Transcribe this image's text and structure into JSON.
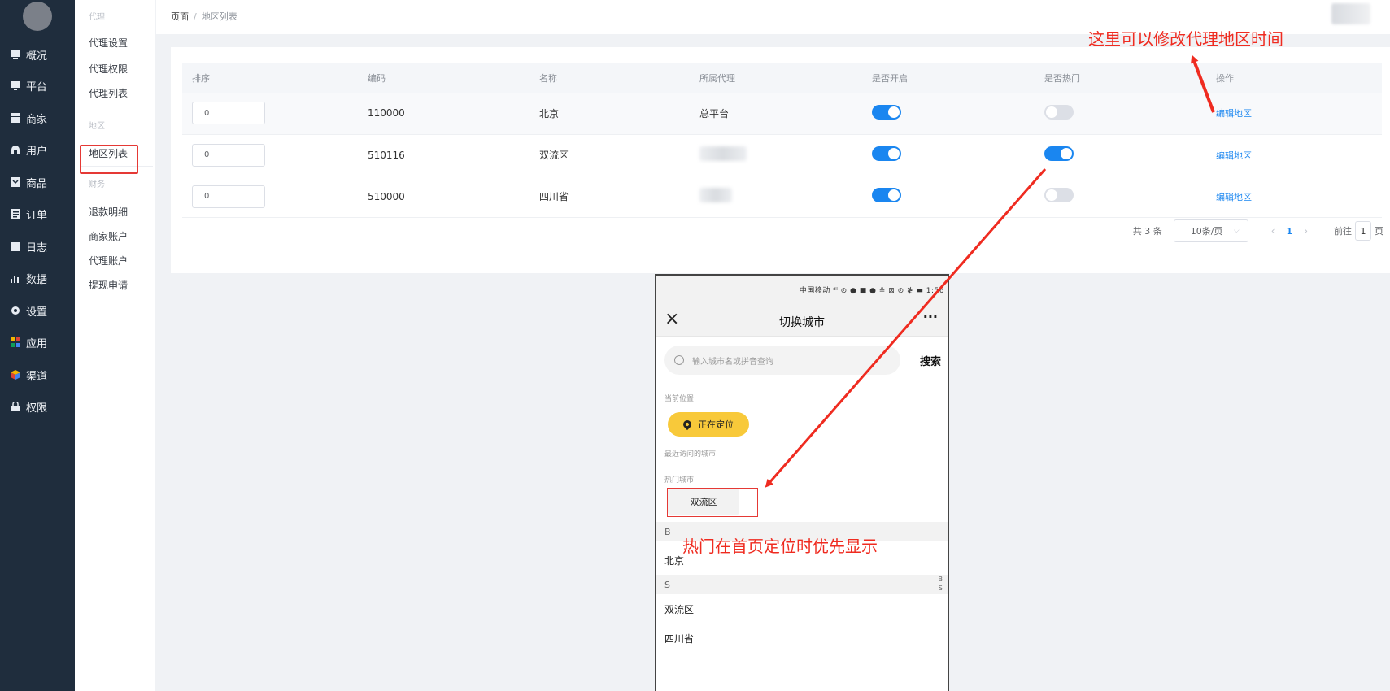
{
  "sidebar": {
    "items": [
      {
        "icon": "dashboard-icon",
        "label": "概况"
      },
      {
        "icon": "monitor-icon",
        "label": "平台"
      },
      {
        "icon": "store-icon",
        "label": "商家"
      },
      {
        "icon": "user-icon",
        "label": "用户"
      },
      {
        "icon": "product-icon",
        "label": "商品"
      },
      {
        "icon": "order-icon",
        "label": "订单"
      },
      {
        "icon": "log-icon",
        "label": "日志"
      },
      {
        "icon": "bar-chart-icon",
        "label": "数据"
      },
      {
        "icon": "gear-icon",
        "label": "设置"
      },
      {
        "icon": "apps-icon",
        "label": "应用"
      },
      {
        "icon": "cube-icon",
        "label": "渠道"
      },
      {
        "icon": "lock-icon",
        "label": "权限"
      }
    ]
  },
  "submenu": {
    "group_agent": "代理",
    "agent_settings": "代理设置",
    "agent_permissions": "代理权限",
    "agent_list": "代理列表",
    "group_region": "地区",
    "region_list": "地区列表",
    "group_finance": "财务",
    "refund_details": "退款明细",
    "merchant_accounts": "商家账户",
    "agent_accounts": "代理账户",
    "withdraw_requests": "提现申请"
  },
  "breadcrumb": {
    "root": "页面",
    "separator": "/",
    "current": "地区列表"
  },
  "table": {
    "headers": {
      "sort": "排序",
      "code": "编码",
      "name": "名称",
      "agent": "所属代理",
      "enabled": "是否开启",
      "hot": "是否热门",
      "action": "操作"
    },
    "rows": [
      {
        "sort": "0",
        "code": "110000",
        "name": "北京",
        "agent": "总平台",
        "enabled": true,
        "hot": false,
        "action": "编辑地区"
      },
      {
        "sort": "0",
        "code": "510116",
        "name": "双流区",
        "agent": "",
        "enabled": true,
        "hot": true,
        "action": "编辑地区"
      },
      {
        "sort": "0",
        "code": "510000",
        "name": "四川省",
        "agent": "",
        "enabled": true,
        "hot": false,
        "action": "编辑地区"
      }
    ]
  },
  "pagination": {
    "total": "共 3 条",
    "page_size": "10条/页",
    "current_page": "1",
    "goto_prefix": "前往",
    "goto_value": "1",
    "goto_suffix": "页"
  },
  "annotations": {
    "top": "这里可以修改代理地区时间",
    "middle": "热门在首页定位时优先显示"
  },
  "phone": {
    "status_bar": "中国移动 ᵈˡ ⊙ ● ■ ● ≗ ⊠ ⊙ ≹ ▬ 1:56",
    "title": "切换城市",
    "more": "···",
    "search_placeholder": "输入城市名或拼音查询",
    "search_button": "搜索",
    "current_location_label": "当前位置",
    "locating": "正在定位",
    "recent_label": "最近访问的城市",
    "hot_label": "热门城市",
    "hot_city": "双流区",
    "letter_b": "B",
    "city_beijing": "北京",
    "letter_s": "S",
    "city_shuangliu": "双流区",
    "city_sichuan": "四川省",
    "index_b": "B",
    "index_s": "S"
  },
  "colors": {
    "sidebar_bg": "#1f2d3d",
    "accent": "#1a86f0",
    "annotation": "#ef2b20",
    "locate_button": "#f8c93a"
  }
}
